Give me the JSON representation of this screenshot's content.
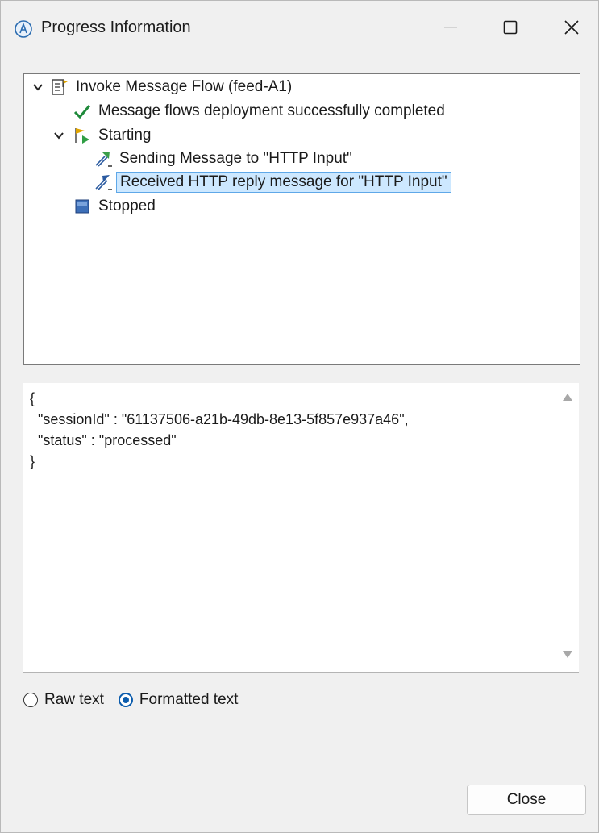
{
  "window": {
    "title": "Progress Information",
    "icon": "app-icon",
    "controls": [
      "minimize-icon",
      "maximize-icon",
      "close-icon"
    ]
  },
  "tree": {
    "items": [
      {
        "label": "Invoke Message Flow (feed-A1)",
        "icon": "flow-doc-icon",
        "expanded": true,
        "depth": 0
      },
      {
        "label": "Message flows deployment successfully completed",
        "icon": "checkmark-icon",
        "depth": 1
      },
      {
        "label": "Starting",
        "icon": "start-flag-icon",
        "expanded": true,
        "depth": 1
      },
      {
        "label": "Sending Message to \"HTTP Input\"",
        "icon": "send-message-icon",
        "depth": 2
      },
      {
        "label": "Received HTTP reply message for \"HTTP Input\"",
        "icon": "receive-message-icon",
        "depth": 2,
        "selected": true
      },
      {
        "label": "Stopped",
        "icon": "stop-icon",
        "depth": 1
      }
    ]
  },
  "detail": {
    "text": "{\n  \"sessionId\" : \"61137506-a21b-49db-8e13-5f857e937a46\",\n  \"status\" : \"processed\"\n}"
  },
  "format": {
    "raw_label": "Raw text",
    "formatted_label": "Formatted text",
    "selected": "formatted"
  },
  "buttons": {
    "close_label": "Close"
  },
  "colors": {
    "selection_bg": "#cde8ff",
    "selection_border": "#5fa8e8",
    "check_green": "#1f8a3b",
    "radio_accent": "#0b5cad"
  }
}
